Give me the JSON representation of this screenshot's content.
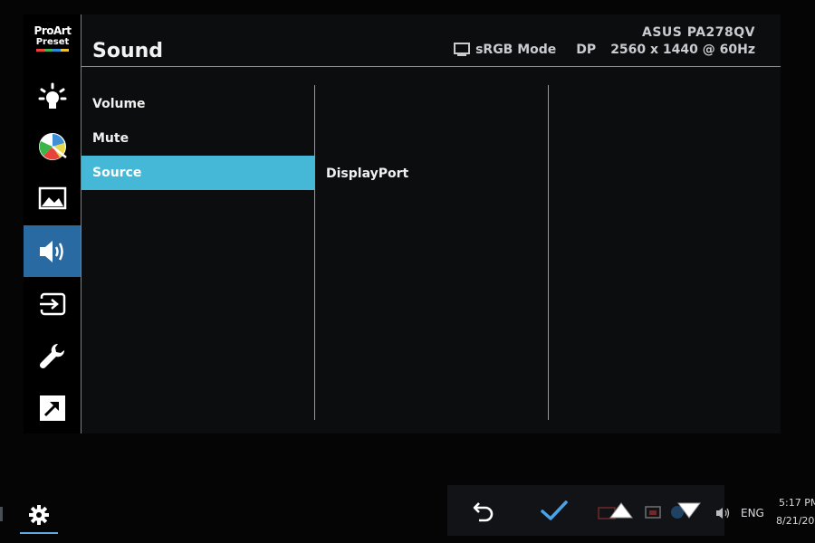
{
  "logo": {
    "line1": "ProArt",
    "line2": "Preset",
    "colors": [
      "#e8433a",
      "#3ab54a",
      "#2c8ad6",
      "#f2c12e"
    ]
  },
  "header": {
    "title": "Sound",
    "model": "ASUS PA278QV",
    "mode": "sRGB Mode",
    "input": "DP",
    "resolution": "2560 x 1440 @ 60Hz"
  },
  "sidebar": {
    "items": [
      {
        "name": "brightness",
        "icon": "sun-icon"
      },
      {
        "name": "color",
        "icon": "color-wheel-icon"
      },
      {
        "name": "image",
        "icon": "image-icon"
      },
      {
        "name": "sound",
        "icon": "speaker-icon",
        "active": true
      },
      {
        "name": "input-select",
        "icon": "input-icon"
      },
      {
        "name": "system-setup",
        "icon": "wrench-icon"
      },
      {
        "name": "shortcut",
        "icon": "arrow-out-icon"
      }
    ]
  },
  "menu": {
    "items": [
      {
        "label": "Volume"
      },
      {
        "label": "Mute"
      },
      {
        "label": "Source",
        "active": true
      }
    ]
  },
  "submenu": {
    "value": "DisplayPort"
  },
  "taskbar": {
    "language": "ENG",
    "time": "5:17 PM",
    "date": "8/21/20"
  },
  "colors": {
    "accent": "#44b8d6",
    "active_nav": "#2a6aa2",
    "background": "#0c0d0f"
  }
}
